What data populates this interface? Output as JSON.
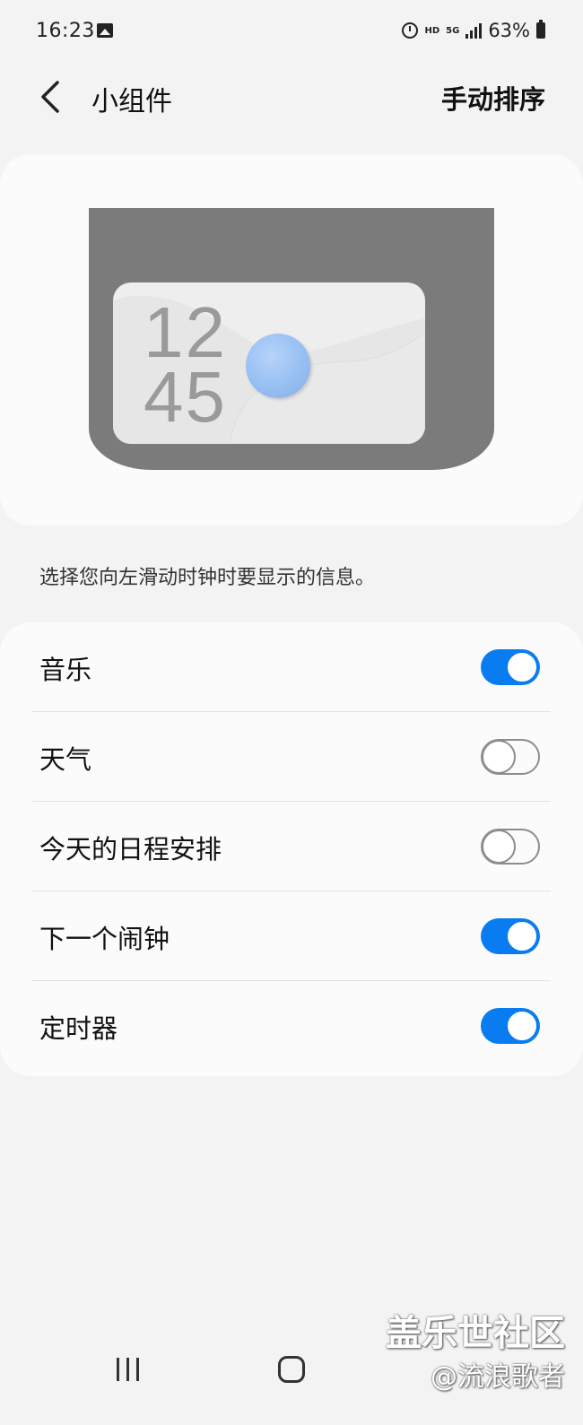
{
  "status_bar": {
    "time": "16:23",
    "network": "HD",
    "generation": "5G",
    "battery": "63%",
    "icons": [
      "image-icon",
      "alarm-icon",
      "signal-icon",
      "battery-icon"
    ]
  },
  "header": {
    "title": "小组件",
    "action": "手动排序"
  },
  "preview": {
    "hour": "12",
    "minute": "45"
  },
  "description": "选择您向左滑动时钟时要显示的信息。",
  "widgets": [
    {
      "label": "音乐",
      "enabled": true
    },
    {
      "label": "天气",
      "enabled": false
    },
    {
      "label": "今天的日程安排",
      "enabled": false
    },
    {
      "label": "下一个闹钟",
      "enabled": true
    },
    {
      "label": "定时器",
      "enabled": true
    }
  ],
  "watermark": {
    "line1": "盖乐世社区",
    "line2": "@流浪歌者"
  },
  "colors": {
    "accent": "#0a7cf2",
    "background": "#f3f3f3",
    "card": "#fbfbfb"
  }
}
